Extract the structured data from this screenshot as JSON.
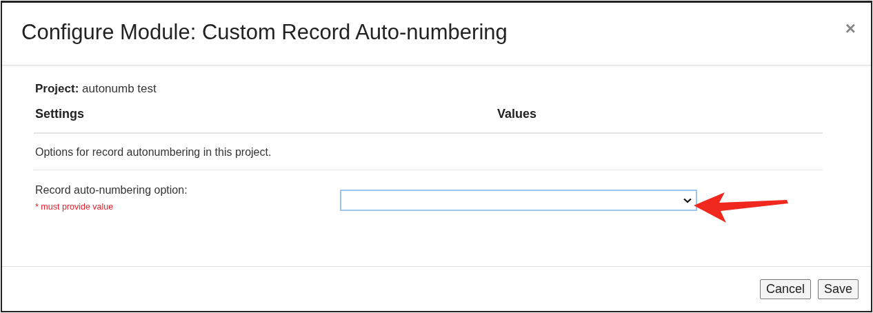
{
  "dialog": {
    "title": "Configure Module: Custom Record Auto-numbering",
    "close": "×"
  },
  "project": {
    "label": "Project:",
    "value": "autonumb test"
  },
  "columns": [
    "Settings",
    "Values"
  ],
  "description": "Options for record autonumbering in this project.",
  "setting": {
    "label": "Record auto-numbering option:",
    "required_note": "* must provide value",
    "focused": true
  },
  "buttons": [
    "Cancel",
    "Save"
  ]
}
